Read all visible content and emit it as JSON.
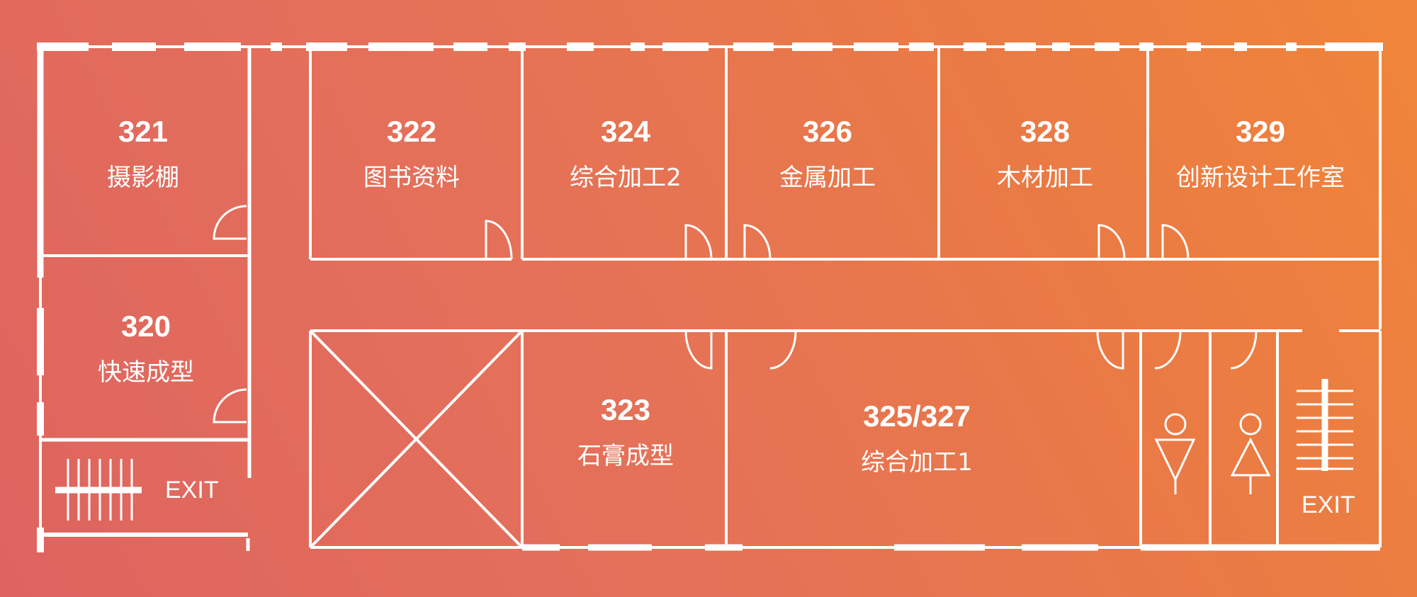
{
  "colors": {
    "background_start": "#de6460",
    "background_end": "#f0853a",
    "lines": "#ffffff"
  },
  "rooms": [
    {
      "number": "321",
      "name": "摄影棚"
    },
    {
      "number": "320",
      "name": "快速成型"
    },
    {
      "number": "322",
      "name": "图书资料"
    },
    {
      "number": "324",
      "name": "综合加工2"
    },
    {
      "number": "326",
      "name": "金属加工"
    },
    {
      "number": "328",
      "name": "木材加工"
    },
    {
      "number": "329",
      "name": "创新设计工作室"
    },
    {
      "number": "323",
      "name": "石膏成型"
    },
    {
      "number": "325/327",
      "name": "综合加工1"
    }
  ],
  "exits": [
    "EXIT",
    "EXIT"
  ],
  "icons": [
    "stairs-icon",
    "stairs-icon",
    "male-restroom-icon",
    "female-restroom-icon",
    "door-swing-icon",
    "windows-icon",
    "elevator-shaft-icon"
  ]
}
